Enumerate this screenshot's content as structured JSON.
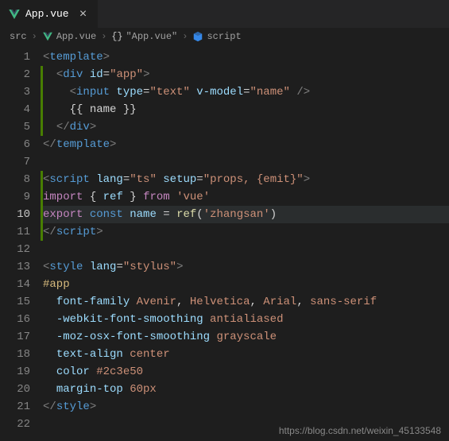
{
  "tab": {
    "label": "App.vue"
  },
  "breadcrumb": {
    "src": "src",
    "file": "App.vue",
    "symbol": "\"App.vue\"",
    "section": "script"
  },
  "lines": {
    "l1": "1",
    "l2": "2",
    "l3": "3",
    "l4": "4",
    "l5": "5",
    "l6": "6",
    "l7": "7",
    "l8": "8",
    "l9": "9",
    "l10": "10",
    "l11": "11",
    "l12": "12",
    "l13": "13",
    "l14": "14",
    "l15": "15",
    "l16": "16",
    "l17": "17",
    "l18": "18",
    "l19": "19",
    "l20": "20",
    "l21": "21",
    "l22": "22"
  },
  "code": {
    "c1": {
      "a": "<",
      "b": "template",
      "c": ">"
    },
    "c2": {
      "a": "<",
      "b": "div",
      "c": " id",
      "d": "=",
      "e": "\"app\"",
      "f": ">"
    },
    "c3": {
      "a": "<",
      "b": "input",
      "c": " type",
      "d": "=",
      "e": "\"text\"",
      "f": " v-model",
      "g": "=",
      "h": "\"name\"",
      "i": " />"
    },
    "c4": {
      "a": "{{ name }}"
    },
    "c5": {
      "a": "</",
      "b": "div",
      "c": ">"
    },
    "c6": {
      "a": "</",
      "b": "template",
      "c": ">"
    },
    "c8": {
      "a": "<",
      "b": "script",
      "c": " lang",
      "d": "=",
      "e": "\"ts\"",
      "f": " setup",
      "g": "=",
      "h": "\"props, {emit}\"",
      "i": ">"
    },
    "c9": {
      "a": "import",
      "b": " { ",
      "c": "ref",
      "d": " } ",
      "e": "from",
      "f": " 'vue'"
    },
    "c10": {
      "a": "export",
      "b": " const",
      "c": " name",
      "d": " = ",
      "e": "ref",
      "f": "(",
      "g": "'zhangsan'",
      "h": ")"
    },
    "c11": {
      "a": "</",
      "b": "script",
      "c": ">"
    },
    "c13": {
      "a": "<",
      "b": "style",
      "c": " lang",
      "d": "=",
      "e": "\"stylus\"",
      "f": ">"
    },
    "c14": {
      "a": "#app"
    },
    "c15": {
      "a": "font-family",
      "b": " Avenir",
      "c": ", ",
      "d": "Helvetica",
      "e": ", ",
      "f": "Arial",
      "g": ", ",
      "h": "sans-serif"
    },
    "c16": {
      "a": "-webkit-font-smoothing",
      "b": " antialiased"
    },
    "c17": {
      "a": "-moz-osx-font-smoothing",
      "b": " grayscale"
    },
    "c18": {
      "a": "text-align",
      "b": " center"
    },
    "c19": {
      "a": "color",
      "b": " #2c3e50"
    },
    "c20": {
      "a": "margin-top",
      "b": " 60px"
    },
    "c21": {
      "a": "</",
      "b": "style",
      "c": ">"
    }
  },
  "watermark": "https://blog.csdn.net/weixin_45133548"
}
